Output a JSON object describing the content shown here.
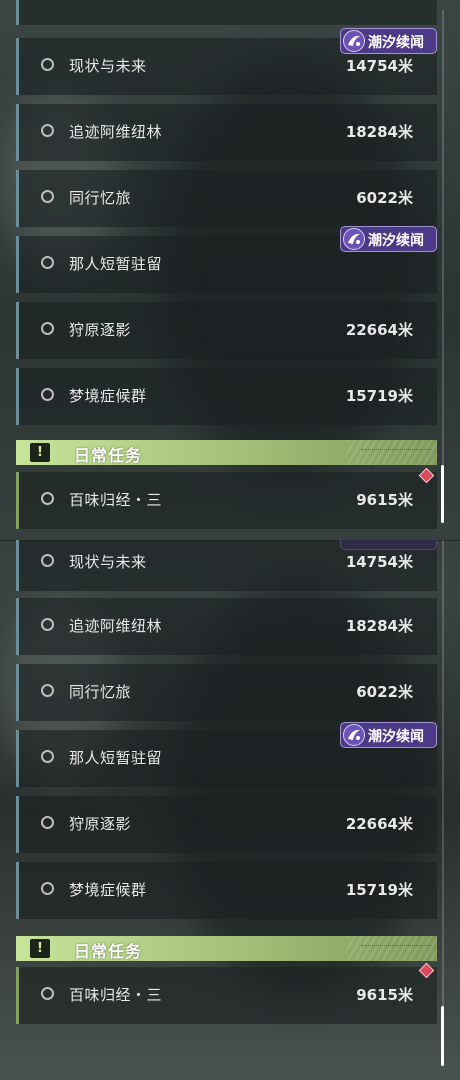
{
  "panels": [
    {
      "tasks": [
        {
          "label": "现状与未来",
          "distance": "14754米"
        },
        {
          "label": "追迹阿维纽林",
          "distance": "18284米"
        },
        {
          "label": "同行忆旅",
          "distance": "6022米"
        },
        {
          "label": "那人短暂驻留",
          "distance": ""
        },
        {
          "label": "狩原逐影",
          "distance": "22664米"
        },
        {
          "label": "梦境症候群",
          "distance": "15719米"
        }
      ],
      "badges": [
        "潮汐续闻",
        "潮汐续闻"
      ],
      "section_header": "日常任务",
      "daily_task": {
        "label": "百味归经・三",
        "distance": "9615米"
      }
    },
    {
      "tasks": [
        {
          "label": "现状与未来",
          "distance": "14754米"
        },
        {
          "label": "追迹阿维纽林",
          "distance": "18284米"
        },
        {
          "label": "同行忆旅",
          "distance": "6022米"
        },
        {
          "label": "那人短暂驻留",
          "distance": ""
        },
        {
          "label": "狩原逐影",
          "distance": "22664米"
        },
        {
          "label": "梦境症候群",
          "distance": "15719米"
        }
      ],
      "badges": [
        "潮汐续闻"
      ],
      "section_header": "日常任务",
      "daily_task": {
        "label": "百味归经・三",
        "distance": "9615米"
      }
    }
  ],
  "colors": {
    "accent_blue": "#6a8f96",
    "accent_green": "#86a062",
    "badge_purple": "#4d3a86",
    "diamond_red": "#d84a5c"
  },
  "icons": {
    "task_status": "circle-icon",
    "section": "exclamation-icon",
    "badge": "tide-emblem-icon",
    "daily_marker": "diamond-icon"
  }
}
